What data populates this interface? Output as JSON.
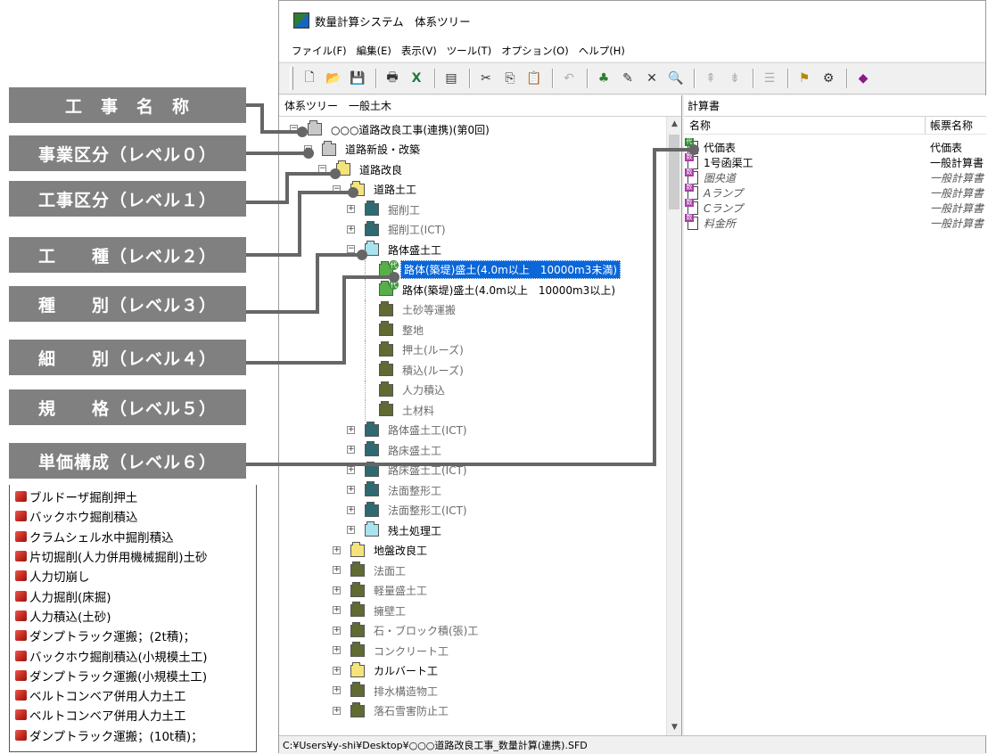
{
  "window": {
    "title": "数量計算システム　体系ツリー",
    "menu": [
      "ファイル(F)",
      "編集(E)",
      "表示(V)",
      "ツール(T)",
      "オプション(O)",
      "ヘルプ(H)"
    ],
    "status_path": "C:¥Users¥y-shi¥Desktop¥○○○道路改良工事_数量計算(連携).SFD"
  },
  "toolbar": {
    "icons": [
      "new-icon",
      "open-icon",
      "save-icon",
      "print-icon",
      "excel-icon",
      "properties-icon",
      "cut-icon",
      "copy-icon",
      "paste-icon",
      "undo-icon",
      "tree-icon",
      "edit-icon",
      "delete-icon",
      "find-icon",
      "level-up-icon",
      "level-down-icon",
      "outline-icon",
      "flag-icon",
      "config-icon",
      "book-icon"
    ]
  },
  "tree_panel": {
    "header": "体系ツリー　一般土木",
    "nodes": [
      {
        "label": "○○○道路改良工事(連携)(第0回)",
        "icon": "gray",
        "depth": 0,
        "expander": "−"
      },
      {
        "label": "道路新設・改築",
        "icon": "gray",
        "depth": 1,
        "expander": "−"
      },
      {
        "label": "道路改良",
        "icon": "yellow",
        "depth": 2,
        "expander": "−"
      },
      {
        "label": "道路土工",
        "icon": "yellow",
        "depth": 3,
        "expander": "−"
      },
      {
        "label": "掘削工",
        "icon": "teal",
        "depth": 4,
        "expander": "+",
        "gray": true
      },
      {
        "label": "掘削工(ICT)",
        "icon": "teal",
        "depth": 4,
        "expander": "+",
        "gray": true
      },
      {
        "label": "路体盛土工",
        "icon": "cyan",
        "depth": 4,
        "expander": "−"
      },
      {
        "label": "路体(築堤)盛土(4.0m以上　10000m3未満)",
        "icon": "green",
        "depth": 5,
        "selected": true
      },
      {
        "label": "路体(築堤)盛土(4.0m以上　10000m3以上)",
        "icon": "green",
        "depth": 5
      },
      {
        "label": "土砂等運搬",
        "icon": "olive",
        "depth": 5,
        "gray": true
      },
      {
        "label": "整地",
        "icon": "olive",
        "depth": 5,
        "gray": true
      },
      {
        "label": "押土(ルーズ)",
        "icon": "olive",
        "depth": 5,
        "gray": true
      },
      {
        "label": "積込(ルーズ)",
        "icon": "olive",
        "depth": 5,
        "gray": true
      },
      {
        "label": "人力積込",
        "icon": "olive",
        "depth": 5,
        "gray": true
      },
      {
        "label": "土材料",
        "icon": "olive",
        "depth": 5,
        "gray": true
      },
      {
        "label": "路体盛土工(ICT)",
        "icon": "teal",
        "depth": 4,
        "expander": "+",
        "gray": true
      },
      {
        "label": "路床盛土工",
        "icon": "teal",
        "depth": 4,
        "expander": "+",
        "gray": true
      },
      {
        "label": "路床盛土工(ICT)",
        "icon": "teal",
        "depth": 4,
        "expander": "+",
        "gray": true
      },
      {
        "label": "法面整形工",
        "icon": "teal",
        "depth": 4,
        "expander": "+",
        "gray": true
      },
      {
        "label": "法面整形工(ICT)",
        "icon": "teal",
        "depth": 4,
        "expander": "+",
        "gray": true
      },
      {
        "label": "残土処理工",
        "icon": "cyan",
        "depth": 4,
        "expander": "+"
      },
      {
        "label": "地盤改良工",
        "icon": "yellow",
        "depth": 3,
        "expander": "+"
      },
      {
        "label": "法面工",
        "icon": "olive",
        "depth": 3,
        "expander": "+",
        "gray": true
      },
      {
        "label": "軽量盛土工",
        "icon": "olive",
        "depth": 3,
        "expander": "+",
        "gray": true
      },
      {
        "label": "擁壁工",
        "icon": "olive",
        "depth": 3,
        "expander": "+",
        "gray": true
      },
      {
        "label": "石・ブロック積(張)工",
        "icon": "olive",
        "depth": 3,
        "expander": "+",
        "gray": true
      },
      {
        "label": "コンクリート工",
        "icon": "olive",
        "depth": 3,
        "expander": "+",
        "gray": true
      },
      {
        "label": "カルバート工",
        "icon": "yellow",
        "depth": 3,
        "expander": "+"
      },
      {
        "label": "排水構造物工",
        "icon": "olive",
        "depth": 3,
        "expander": "+",
        "gray": true
      },
      {
        "label": "落石雪害防止工",
        "icon": "olive",
        "depth": 3,
        "expander": "+",
        "gray": true
      }
    ]
  },
  "calc_panel": {
    "header": "計算書",
    "col_name": "名称",
    "col_type": "帳票名称",
    "rows": [
      {
        "name": "代価表",
        "type": "代価表",
        "icon": "green",
        "italic": false
      },
      {
        "name": "1号函渠工",
        "type": "一般計算書",
        "icon": "purple",
        "italic": false
      },
      {
        "name": "圏央道",
        "type": "一般計算書",
        "icon": "purple",
        "italic": true
      },
      {
        "name": "Aランプ",
        "type": "一般計算書",
        "icon": "purple",
        "italic": true
      },
      {
        "name": "Cランプ",
        "type": "一般計算書",
        "icon": "purple",
        "italic": true
      },
      {
        "name": "料金所",
        "type": "一般計算書",
        "icon": "purple",
        "italic": true
      }
    ]
  },
  "levels": [
    {
      "label": "工　事　名　称"
    },
    {
      "label": "事業区分（レベル０）"
    },
    {
      "label": "工事区分（レベル１）"
    },
    {
      "label": "工　　種（レベル２）"
    },
    {
      "label": "種　　別（レベル３）"
    },
    {
      "label": "細　　別（レベル４）"
    },
    {
      "label": "規　　格（レベル５）"
    },
    {
      "label": "単価構成（レベル６）"
    }
  ],
  "cost_items": [
    "ブルドーザ掘削押土",
    "バックホウ掘削積込",
    "クラムシェル水中掘削積込",
    "片切掘削(人力併用機械掘削)土砂",
    "人力切崩し",
    "人力掘削(床掘)",
    "人力積込(土砂)",
    "ダンプトラック運搬；(2t積)；",
    "バックホウ掘削積込(小規模土工)",
    "ダンプトラック運搬(小規模土工)",
    "ベルトコンベア併用人力土工",
    "ベルトコンベア併用人力土工",
    "ダンプトラック運搬；(10t積)；"
  ]
}
